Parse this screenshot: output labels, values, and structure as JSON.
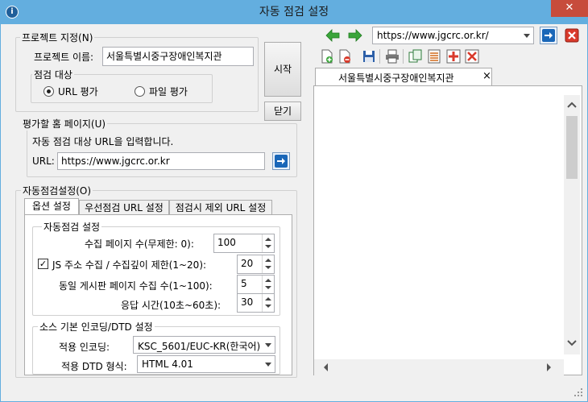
{
  "window": {
    "title": "자동 점검 설정",
    "close_glyph": "✕",
    "app_icon_glyph": "i"
  },
  "project": {
    "legend": "프로젝트 지정(N)",
    "name_label": "프로젝트 이름:",
    "name_value": "서울특별시중구장애인복지관",
    "target_legend": "점검 대상",
    "radio_url": "URL 평가",
    "radio_file": "파일 평가",
    "start_button": "시작",
    "close_button": "닫기"
  },
  "homepage": {
    "legend": "평가할 홈 페이지(U)",
    "instruction": "자동 점검 대상 URL을 입력합니다.",
    "url_label": "URL:",
    "url_value": "https://www.jgcrc.or.kr"
  },
  "auto_settings": {
    "legend": "자동점검설정(O)",
    "tabs": [
      "옵션 설정",
      "우선점검 URL 설정",
      "점검시 제외 URL 설정"
    ],
    "group_legend": "자동점검 설정",
    "collect_pages_label": "수집 페이지 수(무제한: 0):",
    "collect_pages_value": "100",
    "js_label": "JS 주소 수집  / 수집깊이 제한(1~20):",
    "js_checked_glyph": "✓",
    "js_value": "20",
    "board_label": "동일 게시판 페이지 수집 수(1~100):",
    "board_value": "5",
    "timeout_label": "응답 시간(10초~60초):",
    "timeout_value": "30",
    "encoding_legend": "소스 기본 인코딩/DTD 설정",
    "encoding_label": "적용 인코딩:",
    "encoding_value": "KSC_5601/EUC-KR(한국어)",
    "dtd_label": "적용 DTD 형식:",
    "dtd_value": "HTML 4.01"
  },
  "browser": {
    "address": "https://www.jgcrc.or.kr/",
    "tab_label": "서울특별시중구장애인복지관",
    "tab_close": "×"
  },
  "colors": {
    "titlebar": "#63aedf",
    "close": "#c74c3c",
    "nav_green": "#3aa53a",
    "go_blue": "#1a67b8"
  }
}
